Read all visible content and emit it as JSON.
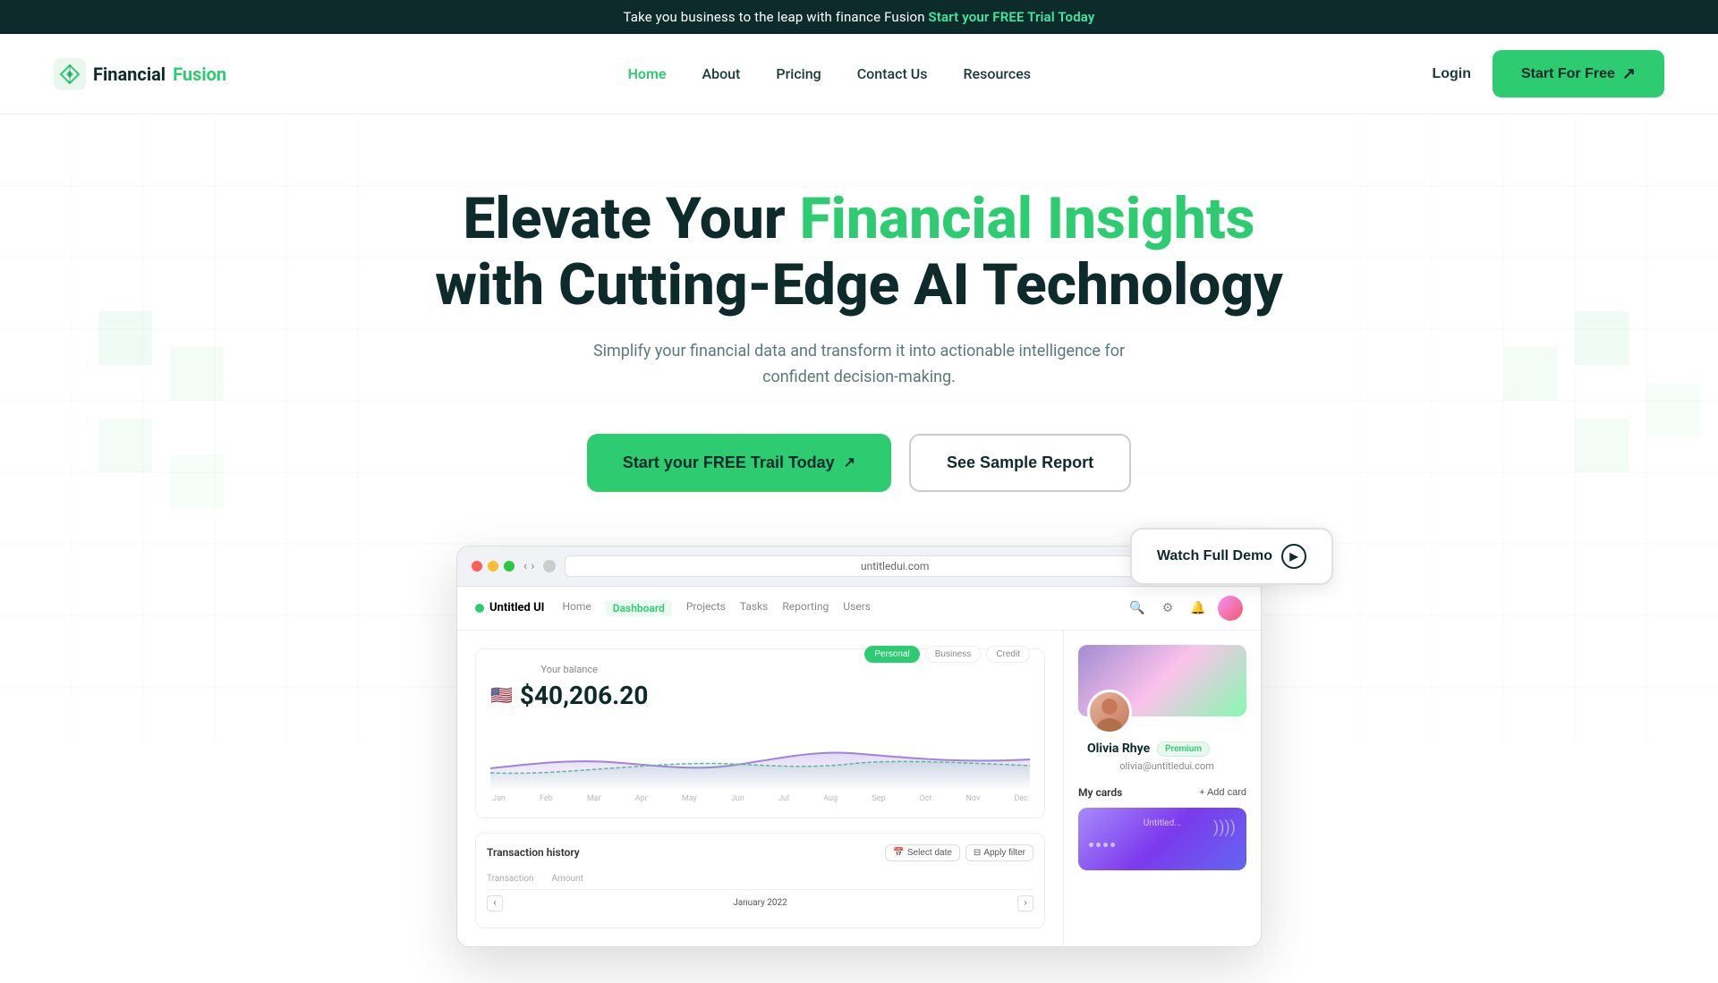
{
  "banner": {
    "text": "Take you business to the leap with finance Fusion ",
    "highlight": "Start your FREE Trial Today"
  },
  "navbar": {
    "logo_text_1": "Financial",
    "logo_text_2": "Fusion",
    "links": [
      {
        "label": "Home",
        "active": true
      },
      {
        "label": "About",
        "active": false
      },
      {
        "label": "Pricing",
        "active": false
      },
      {
        "label": "Contact Us",
        "active": false
      },
      {
        "label": "Resources",
        "active": false
      }
    ],
    "login_label": "Login",
    "start_free_label": "Start For Free"
  },
  "hero": {
    "title_1": "Elevate Your ",
    "title_green": "Financial Insights",
    "title_2": "with Cutting-Edge AI Technology",
    "subtitle": "Simplify your financial data and transform it into actionable intelligence for confident decision-making.",
    "cta_primary": "Start your FREE Trail Today",
    "cta_secondary": "See Sample Report"
  },
  "dashboard_preview": {
    "url": "untitledui.com",
    "nav_items": [
      "Untitled UI",
      "Home",
      "Dashboard",
      "Projects",
      "Tasks",
      "Reporting",
      "Users"
    ],
    "active_nav": "Dashboard",
    "balance_label": "Your balance",
    "balance_amount": "$40,206.20",
    "balance_tabs": [
      "Personal",
      "Business",
      "Credit"
    ],
    "active_balance_tab": "Personal",
    "chart_months": [
      "Jan",
      "Feb",
      "Mar",
      "Apr",
      "May",
      "Jun",
      "Jul",
      "Aug",
      "Sep",
      "Oct",
      "Nov",
      "Dec"
    ],
    "transaction_title": "Transaction history",
    "date_btn": "Select date",
    "filter_btn": "Apply filter",
    "trans_cols": [
      "Transaction",
      "Amount"
    ],
    "trans_month": "January 2022",
    "profile_name": "Olivia Rhye",
    "profile_badge": "Premium",
    "profile_email": "olivia@untitledui.com",
    "cards_title": "My cards",
    "add_card": "+ Add card",
    "card_label": "Untitled..."
  },
  "watch_demo": {
    "label": "Watch Full Demo"
  },
  "colors": {
    "green_accent": "#2ecc71",
    "dark": "#0d2b2b",
    "banner_bg": "#0d2b2b"
  }
}
